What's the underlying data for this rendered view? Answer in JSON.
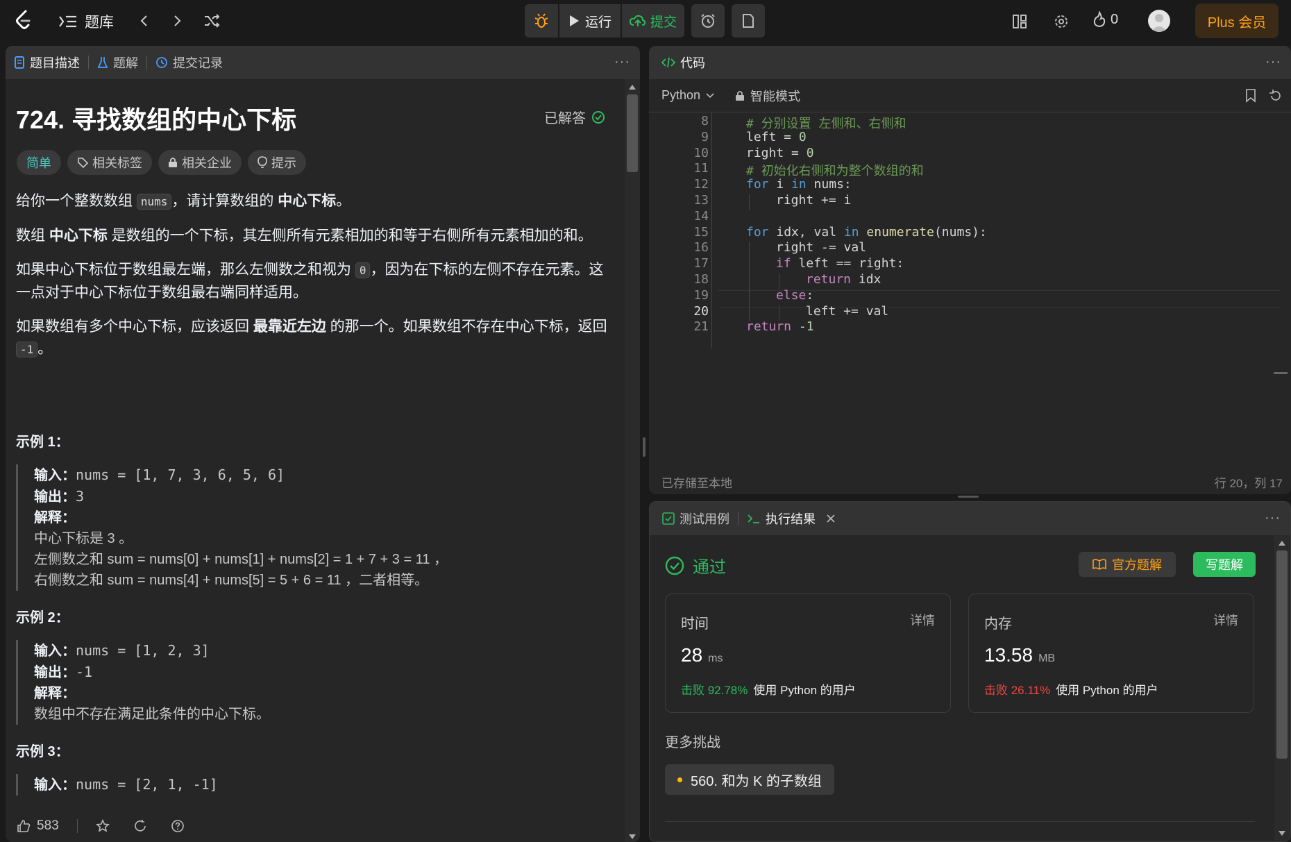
{
  "topbar": {
    "problem_bank": "题库",
    "run": "运行",
    "submit": "提交",
    "streak_count": "0",
    "plus": "Plus 会员"
  },
  "left_panel": {
    "tabs": [
      "题目描述",
      "题解",
      "提交记录"
    ],
    "title": "724. 寻找数组的中心下标",
    "solved": "已解答",
    "tags": [
      "简单",
      "相关标签",
      "相关企业",
      "提示"
    ],
    "p1": {
      "a": "给你一个整数数组 ",
      "code": "nums",
      "b": "，请计算数组的 ",
      "bold": "中心下标",
      "c": "。"
    },
    "p2": {
      "a": "数组 ",
      "bold": "中心下标",
      "b": " 是数组的一个下标，其左侧所有元素相加的和等于右侧所有元素相加的和。"
    },
    "p3": {
      "a": "如果中心下标位于数组最左端，那么左侧数之和视为 ",
      "code": "0",
      "b": "，因为在下标的左侧不存在元素。这一点对于中心下标位于数组最右端同样适用。"
    },
    "p4": {
      "a": "如果数组有多个中心下标，应该返回 ",
      "bold": "最靠近左边",
      "b": " 的那一个。如果数组不存在中心下标，返回 ",
      "code": "-1",
      "c": "。"
    },
    "examples": [
      {
        "heading": "示例 1：",
        "input_label": "输入：",
        "input": "nums = [1, 7, 3, 6, 5, 6]",
        "output_label": "输出：",
        "output": "3",
        "explain_label": "解释：",
        "explain": [
          "中心下标是 3 。",
          "左侧数之和 sum = nums[0] + nums[1] + nums[2] = 1 + 7 + 3 = 11 ，",
          "右侧数之和 sum = nums[4] + nums[5] = 5 + 6 = 11 ，二者相等。"
        ]
      },
      {
        "heading": "示例 2：",
        "input_label": "输入：",
        "input": "nums = [1, 2, 3]",
        "output_label": "输出：",
        "output": "-1",
        "explain_label": "解释：",
        "explain": [
          "数组中不存在满足此条件的中心下标。"
        ]
      },
      {
        "heading": "示例 3：",
        "input_label": "输入：",
        "input": "nums = [2, 1, -1]"
      }
    ],
    "likes": "583"
  },
  "code_panel": {
    "tab": "代码",
    "language": "Python",
    "mode": "智能模式",
    "saved": "已存储至本地",
    "cursor": "行 20，列 17",
    "lines": [
      {
        "n": "8",
        "indent": 1,
        "text": "# 分别设置 左侧和、右侧和"
      },
      {
        "n": "9",
        "indent": 1,
        "text": "left = 0"
      },
      {
        "n": "10",
        "indent": 1,
        "text": "right = 0"
      },
      {
        "n": "11",
        "indent": 1,
        "text": "# 初始化右侧和为整个数组的和"
      },
      {
        "n": "12",
        "indent": 1,
        "text": "for i in nums:"
      },
      {
        "n": "13",
        "indent": 2,
        "text": "right += i"
      },
      {
        "n": "14",
        "indent": 0,
        "text": ""
      },
      {
        "n": "15",
        "indent": 1,
        "text": "for idx, val in enumerate(nums):"
      },
      {
        "n": "16",
        "indent": 2,
        "text": "right -= val"
      },
      {
        "n": "17",
        "indent": 2,
        "text": "if left == right:"
      },
      {
        "n": "18",
        "indent": 3,
        "text": "return idx"
      },
      {
        "n": "19",
        "indent": 2,
        "text": "else:"
      },
      {
        "n": "20",
        "indent": 3,
        "text": "left += val"
      },
      {
        "n": "21",
        "indent": 1,
        "text": "return -1"
      }
    ]
  },
  "result_panel": {
    "tabs": [
      "测试用例",
      "执行结果"
    ],
    "status": "通过",
    "official_solution": "官方题解",
    "write_solution": "写题解",
    "time": {
      "label": "时间",
      "detail": "详情",
      "value": "28",
      "unit": "ms",
      "beat": "击败 92.78%",
      "suffix": "使用 Python 的用户"
    },
    "memory": {
      "label": "内存",
      "detail": "详情",
      "value": "13.58",
      "unit": "MB",
      "beat": "击败 26.11%",
      "suffix": "使用 Python 的用户"
    },
    "more": "更多挑战",
    "challenge": "560. 和为 K 的子数组"
  },
  "colors": {
    "accent_green": "#2cbb5d",
    "accent_orange": "#ffa116",
    "beat_red": "#ef4743"
  }
}
